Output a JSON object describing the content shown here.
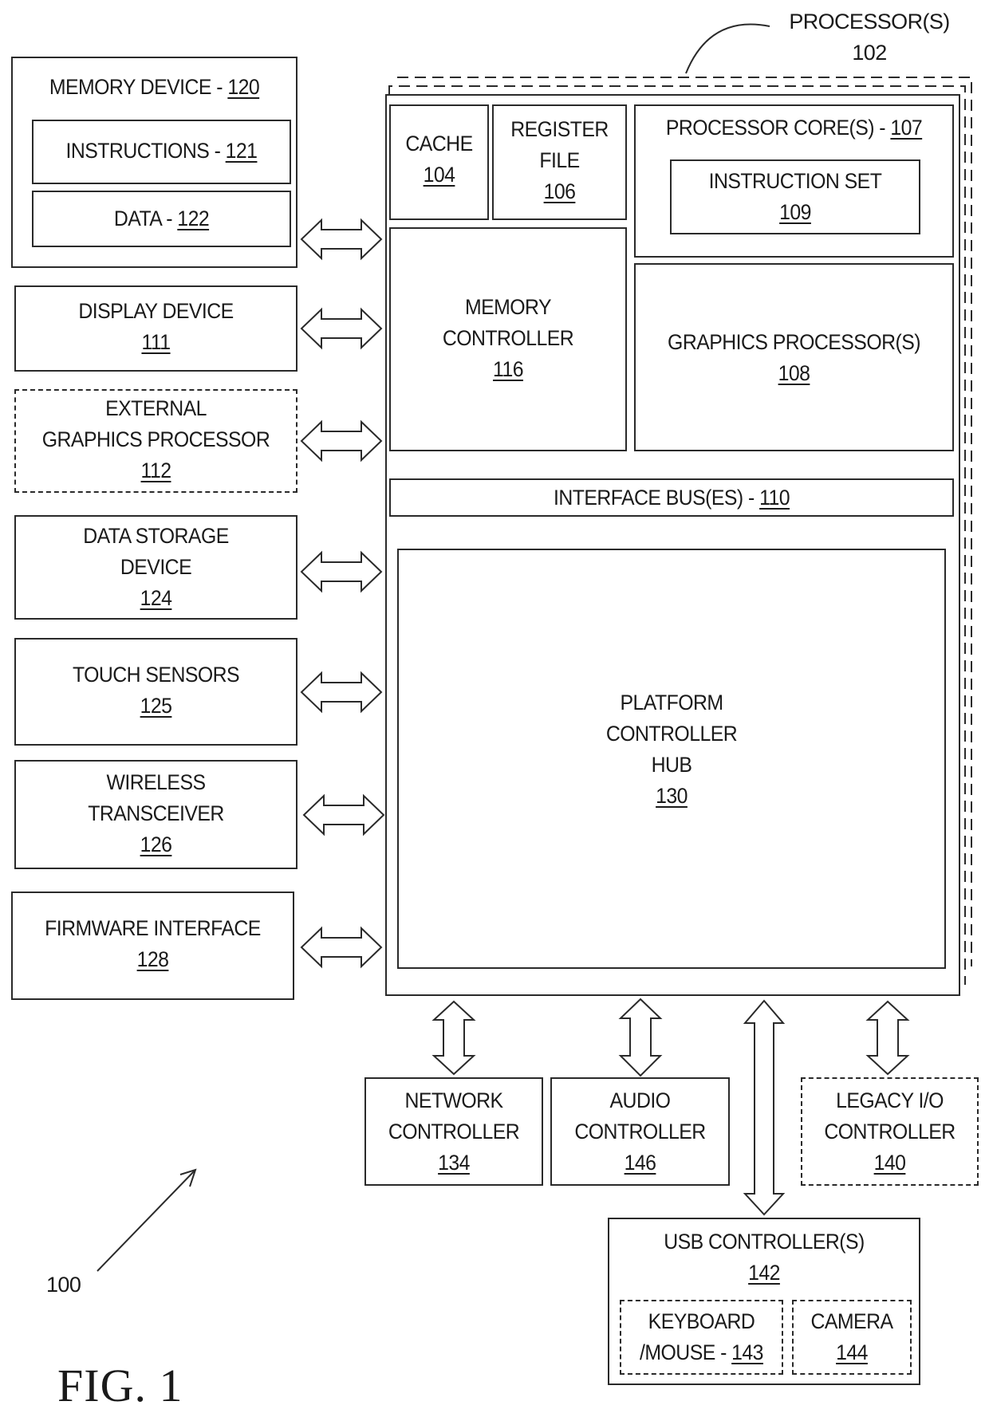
{
  "figure": {
    "title": "FIG. 1",
    "system_ref": "100"
  },
  "processor": {
    "label": "PROCESSOR(S)",
    "ref": "102",
    "cache": {
      "label": "CACHE",
      "ref": "104"
    },
    "register_file": {
      "label_line1": "REGISTER",
      "label_line2": "FILE",
      "ref": "106"
    },
    "processor_core": {
      "label": "PROCESSOR CORE(S) - ",
      "ref": "107"
    },
    "instruction_set": {
      "label": "INSTRUCTION SET",
      "ref": "109"
    },
    "memory_controller": {
      "label_line1": "MEMORY",
      "label_line2": "CONTROLLER",
      "ref": "116"
    },
    "graphics_processor": {
      "label": "GRAPHICS PROCESSOR(S)",
      "ref": "108"
    },
    "interface_bus": {
      "label": "INTERFACE BUS(ES) - ",
      "ref": "110"
    },
    "platform_controller_hub": {
      "label_line1": "PLATFORM",
      "label_line2": "CONTROLLER",
      "label_line3": "HUB",
      "ref": "130"
    }
  },
  "left_devices": {
    "memory_device": {
      "label": "MEMORY DEVICE - ",
      "ref": "120",
      "instructions": {
        "label": "INSTRUCTIONS - ",
        "ref": "121"
      },
      "data": {
        "label": "DATA - ",
        "ref": "122"
      }
    },
    "display_device": {
      "label": "DISPLAY DEVICE",
      "ref": "111"
    },
    "external_graphics": {
      "label_line1": "EXTERNAL",
      "label_line2": "GRAPHICS PROCESSOR",
      "ref": "112"
    },
    "data_storage": {
      "label_line1": "DATA STORAGE",
      "label_line2": "DEVICE",
      "ref": "124"
    },
    "touch_sensors": {
      "label": "TOUCH SENSORS",
      "ref": "125"
    },
    "wireless_transceiver": {
      "label_line1": "WIRELESS",
      "label_line2": "TRANSCEIVER",
      "ref": "126"
    },
    "firmware_interface": {
      "label": "FIRMWARE INTERFACE",
      "ref": "128"
    }
  },
  "bottom_devices": {
    "network_controller": {
      "label_line1": "NETWORK",
      "label_line2": "CONTROLLER",
      "ref": "134"
    },
    "audio_controller": {
      "label_line1": "AUDIO",
      "label_line2": "CONTROLLER",
      "ref": "146"
    },
    "legacy_io_controller": {
      "label_line1": "LEGACY I/O",
      "label_line2": "CONTROLLER",
      "ref": "140"
    },
    "usb_controller": {
      "label": "USB CONTROLLER(S)",
      "ref": "142",
      "keyboard_mouse": {
        "label_line1": "KEYBOARD",
        "label_line2": "/MOUSE - ",
        "ref": "143"
      },
      "camera": {
        "label": "CAMERA",
        "ref": "144"
      }
    }
  }
}
